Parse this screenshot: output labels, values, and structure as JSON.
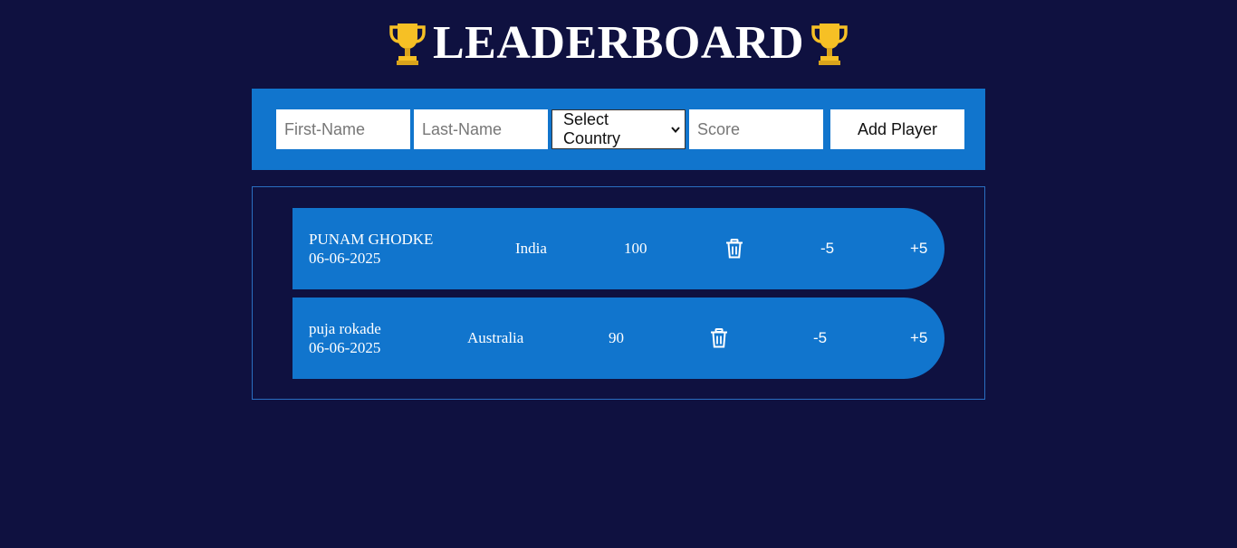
{
  "header": {
    "title": "LEADERBOARD",
    "trophy_icon": "trophy-icon",
    "trophy_color": "#f6c025"
  },
  "form": {
    "first_name_placeholder": "First-Name",
    "last_name_placeholder": "Last-Name",
    "country_select_value": "Select Country",
    "score_placeholder": "Score",
    "add_button_label": "Add Player"
  },
  "players": [
    {
      "name": "PUNAM GHODKE",
      "date": "06-06-2025",
      "country": "India",
      "score": "100",
      "delete_icon": "trash-icon",
      "minus_label": "-5",
      "plus_label": "+5"
    },
    {
      "name": "puja rokade",
      "date": "06-06-2025",
      "country": "Australia",
      "score": "90",
      "delete_icon": "trash-icon",
      "minus_label": "-5",
      "plus_label": "+5"
    }
  ],
  "colors": {
    "background": "#0f1140",
    "accent": "#1175cd",
    "text": "#ffffff"
  }
}
